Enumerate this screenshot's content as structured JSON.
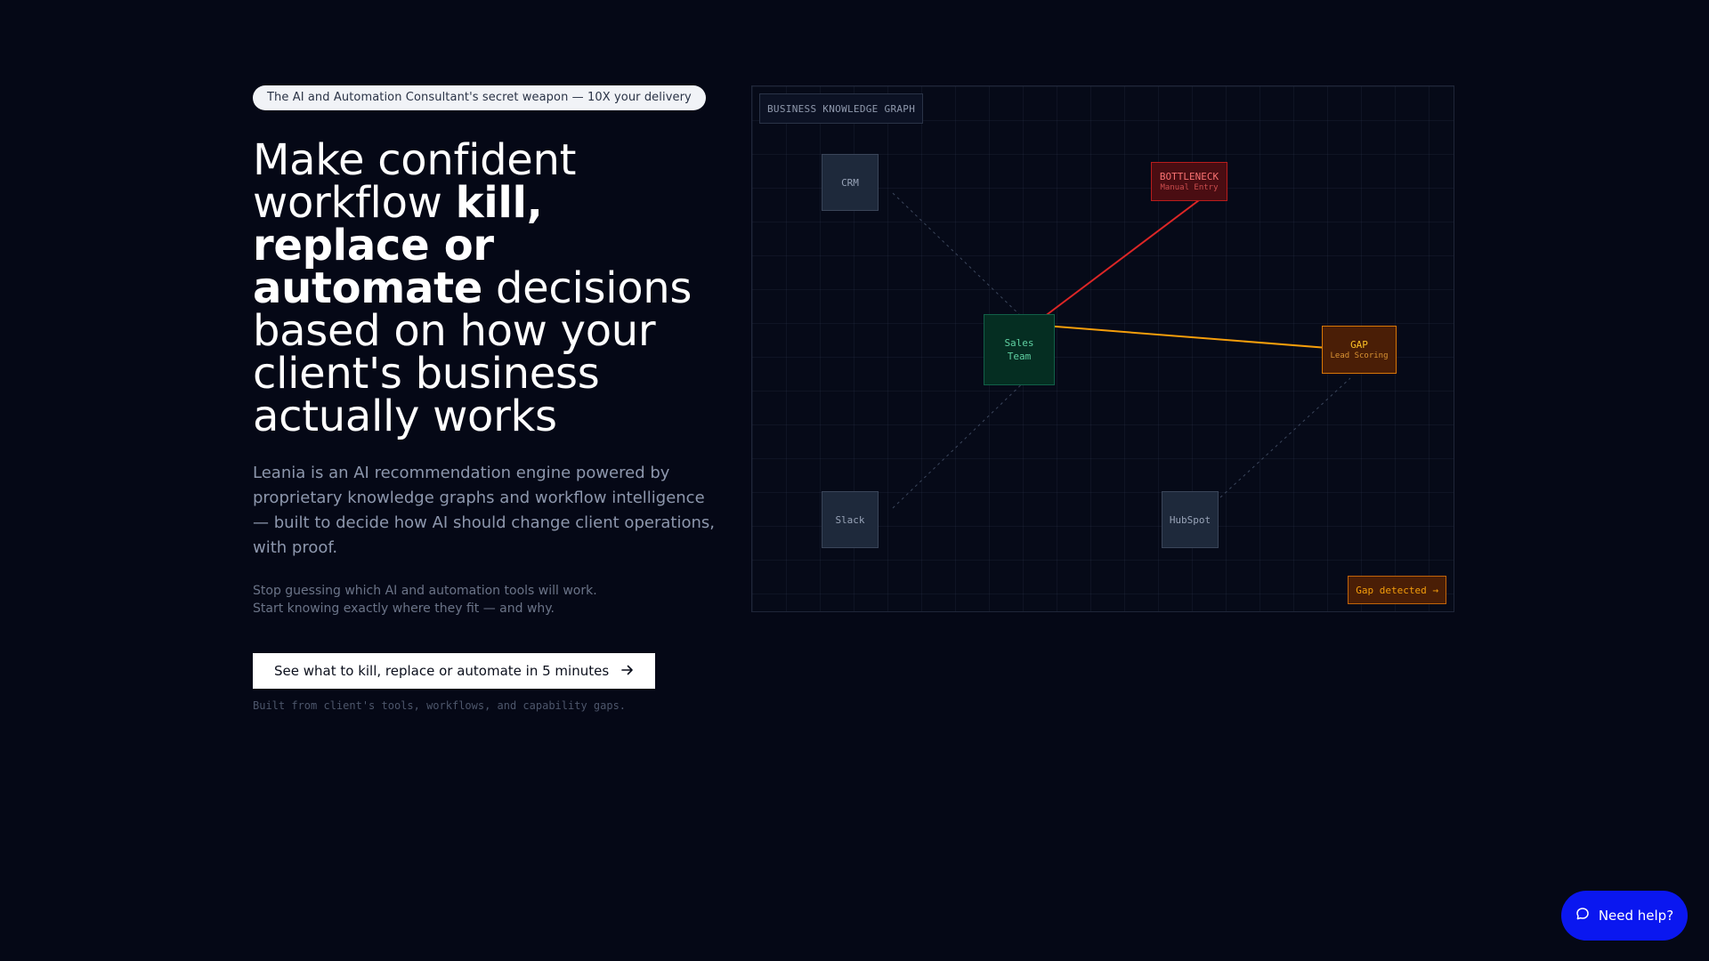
{
  "hero": {
    "badge": "The AI and Automation Consultant's secret weapon — 10X your delivery",
    "headline": {
      "part1": "Make confident workflow ",
      "bold1": "kill, replace or automate",
      "part2": " decisions based on how your client's business actually works"
    },
    "lead": "Leania is an AI recommendation engine powered by proprietary knowledge graphs and workflow intelligence — built to decide how AI should change client operations, with proof.",
    "sub_line1": "Stop guessing which AI and automation tools will work.",
    "sub_line2": "Start knowing exactly where they fit — and why.",
    "cta_label": "See what to kill, replace or automate in 5 minutes",
    "cta_icon": "arrow-right-icon",
    "cta_note": "Built from client's tools, workflows, and capability gaps."
  },
  "graph": {
    "title": "BUSINESS KNOWLEDGE GRAPH",
    "nodes": {
      "crm": "CRM",
      "bottleneck_main": "BOTTLENECK",
      "bottleneck_sub": "Manual Entry",
      "center_line1": "Sales",
      "center_line2": "Team",
      "gap_main": "GAP",
      "gap_sub": "Lead Scoring",
      "slack": "Slack",
      "hubspot": "HubSpot"
    },
    "gap_chip": "Gap detected →",
    "colors": {
      "bottleneck_edge": "#dc2626",
      "gap_edge": "#f59e0b",
      "dashed_edge": "#3b465c"
    }
  },
  "help": {
    "label": "Need help?",
    "icon": "chat-bubble-icon",
    "color": "#0a17f0"
  }
}
